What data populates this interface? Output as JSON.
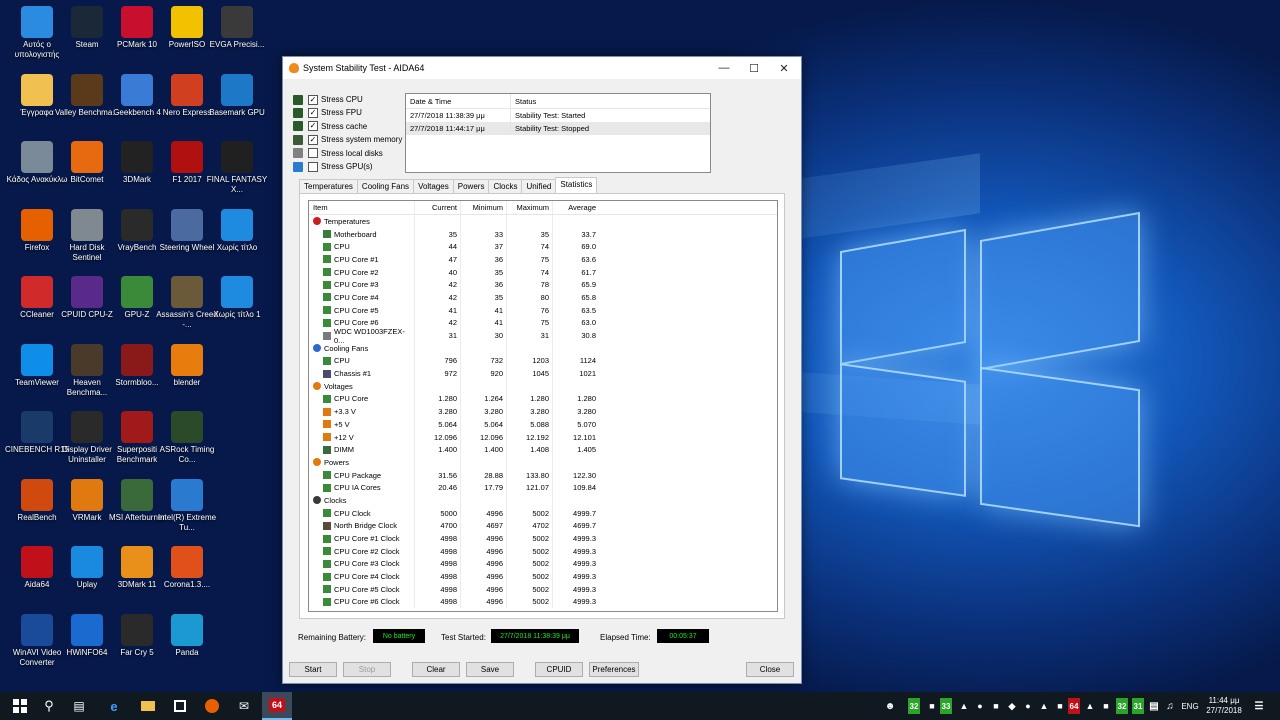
{
  "desktop": {
    "icons": [
      {
        "label": "Αυτός ο υπολογιστής",
        "icon": "computer-icon",
        "color": "#2a8be0"
      },
      {
        "label": "Steam",
        "icon": "steam-icon",
        "color": "#1b2838"
      },
      {
        "label": "PCMark 10",
        "icon": "pcmark-icon",
        "color": "#c8102e"
      },
      {
        "label": "PowerISO",
        "icon": "disc-icon",
        "color": "#f2c200"
      },
      {
        "label": "EVGA Precisi...",
        "icon": "evga-icon",
        "color": "#3a3a3a"
      },
      {
        "label": "Έγγραφα",
        "icon": "documents-icon",
        "color": "#f0c050"
      },
      {
        "label": "Valley Benchma...",
        "icon": "valley-icon",
        "color": "#5a3a1a"
      },
      {
        "label": "Geekbench 4",
        "icon": "geekbench-icon",
        "color": "#3a7bd5"
      },
      {
        "label": "Nero Express",
        "icon": "nero-icon",
        "color": "#d04020"
      },
      {
        "label": "Basemark GPU",
        "icon": "basemark-icon",
        "color": "#1e78c8"
      },
      {
        "label": "Κάδος Ανακύκλω",
        "icon": "recycle-bin-icon",
        "color": "#7a8a99"
      },
      {
        "label": "BitComet",
        "icon": "bitcomet-icon",
        "color": "#e86a10"
      },
      {
        "label": "3DMark",
        "icon": "3dmark-icon",
        "color": "#222222"
      },
      {
        "label": "F1 2017",
        "icon": "f1-icon",
        "color": "#b01010"
      },
      {
        "label": "FINAL FANTASY X...",
        "icon": "final-fantasy-icon",
        "color": "#202020"
      },
      {
        "label": "Firefox",
        "icon": "firefox-icon",
        "color": "#e66000"
      },
      {
        "label": "Hard Disk Sentinel",
        "icon": "hdd-icon",
        "color": "#808890"
      },
      {
        "label": "VrayBench",
        "icon": "vray-icon",
        "color": "#2a2a2a"
      },
      {
        "label": "Steering Wheel",
        "icon": "steering-wheel-icon",
        "color": "#4a6aa0"
      },
      {
        "label": "Χωρίς τίτλο",
        "icon": "window-icon",
        "color": "#1e8ae0"
      },
      {
        "label": "CCleaner",
        "icon": "ccleaner-icon",
        "color": "#d02a2a"
      },
      {
        "label": "CPUID CPU-Z",
        "icon": "cpuz-icon",
        "color": "#5a2a8a"
      },
      {
        "label": "GPU-Z",
        "icon": "gpuz-icon",
        "color": "#3a8a3a"
      },
      {
        "label": "Assassin's Creed -...",
        "icon": "assassins-creed-icon",
        "color": "#6a5a3a"
      },
      {
        "label": "Χωρίς τίτλο 1",
        "icon": "window-icon",
        "color": "#1e8ae0"
      },
      {
        "label": "TeamViewer",
        "icon": "teamviewer-icon",
        "color": "#0e8ee9"
      },
      {
        "label": "Heaven Benchma...",
        "icon": "heaven-icon",
        "color": "#4a3a2a"
      },
      {
        "label": "Stormbloo...",
        "icon": "stormblood-icon",
        "color": "#8a1a1a"
      },
      {
        "label": "blender",
        "icon": "blender-icon",
        "color": "#e87d0d"
      },
      {
        "label": "",
        "icon": "",
        "color": ""
      },
      {
        "label": "CINEBENCH R15",
        "icon": "cinebench-icon",
        "color": "#1a3a6a"
      },
      {
        "label": "Display Driver Uninstaller",
        "icon": "ddu-icon",
        "color": "#2a2a2a"
      },
      {
        "label": "Superpositi Benchmark",
        "icon": "superposition-icon",
        "color": "#a01a1a"
      },
      {
        "label": "ASRock Timing Co...",
        "icon": "asrock-icon",
        "color": "#2a4a2a"
      },
      {
        "label": "",
        "icon": "",
        "color": ""
      },
      {
        "label": "RealBench",
        "icon": "realbench-icon",
        "color": "#d04a10"
      },
      {
        "label": "VRMark",
        "icon": "vrmark-icon",
        "color": "#e07a10"
      },
      {
        "label": "MSI Afterburner",
        "icon": "msi-icon",
        "color": "#3a6a3a"
      },
      {
        "label": "Intel(R) Extreme Tu...",
        "icon": "intel-xtu-icon",
        "color": "#2a7ad0"
      },
      {
        "label": "",
        "icon": "",
        "color": ""
      },
      {
        "label": "Aida64",
        "icon": "aida64-icon",
        "color": "#c0101a"
      },
      {
        "label": "Uplay",
        "icon": "uplay-icon",
        "color": "#1a8ae0"
      },
      {
        "label": "3DMark 11",
        "icon": "3dmark11-icon",
        "color": "#e8901a"
      },
      {
        "label": "Corona1.3....",
        "icon": "corona-icon",
        "color": "#e0501a"
      },
      {
        "label": "",
        "icon": "",
        "color": ""
      },
      {
        "label": "WinAVI Video Converter",
        "icon": "winavi-icon",
        "color": "#1a4a9a"
      },
      {
        "label": "HWiNFO64",
        "icon": "hwinfo-icon",
        "color": "#1a6ad0"
      },
      {
        "label": "Far Cry 5",
        "icon": "farcry-icon",
        "color": "#2a2a2a"
      },
      {
        "label": "Panda",
        "icon": "panda-icon",
        "color": "#1a9ad0"
      }
    ]
  },
  "window": {
    "title": "System Stability Test - AIDA64",
    "stress": [
      {
        "label": "Stress CPU",
        "checked": true,
        "icon": "cpu-icon"
      },
      {
        "label": "Stress FPU",
        "checked": true,
        "icon": "fpu-icon"
      },
      {
        "label": "Stress cache",
        "checked": true,
        "icon": "cache-icon"
      },
      {
        "label": "Stress system memory",
        "checked": true,
        "icon": "memory-icon"
      },
      {
        "label": "Stress local disks",
        "checked": false,
        "icon": "disk-icon"
      },
      {
        "label": "Stress GPU(s)",
        "checked": false,
        "icon": "gpu-icon"
      }
    ],
    "log": {
      "headers": [
        "Date & Time",
        "Status"
      ],
      "rows": [
        {
          "time": "27/7/2018 11:38:39 μμ",
          "status": "Stability Test: Started"
        },
        {
          "time": "27/7/2018 11:44:17 μμ",
          "status": "Stability Test: Stopped"
        }
      ]
    },
    "tabs": [
      "Temperatures",
      "Cooling Fans",
      "Voltages",
      "Powers",
      "Clocks",
      "Unified",
      "Statistics"
    ],
    "active_tab": "Statistics",
    "stats": {
      "headers": [
        "Item",
        "Current",
        "Minimum",
        "Maximum",
        "Average"
      ],
      "rows": [
        {
          "kind": "group",
          "name": "Temperatures",
          "icon": "thermometer-icon"
        },
        {
          "kind": "item",
          "name": "Motherboard",
          "icon": "motherboard-icon",
          "v": [
            "35",
            "33",
            "35",
            "33.7"
          ]
        },
        {
          "kind": "item",
          "name": "CPU",
          "icon": "cpu-icon",
          "v": [
            "44",
            "37",
            "74",
            "69.0"
          ]
        },
        {
          "kind": "item",
          "name": "CPU Core #1",
          "icon": "cpu-icon",
          "v": [
            "47",
            "36",
            "75",
            "63.6"
          ]
        },
        {
          "kind": "item",
          "name": "CPU Core #2",
          "icon": "cpu-icon",
          "v": [
            "40",
            "35",
            "74",
            "61.7"
          ]
        },
        {
          "kind": "item",
          "name": "CPU Core #3",
          "icon": "cpu-icon",
          "v": [
            "42",
            "36",
            "78",
            "65.9"
          ]
        },
        {
          "kind": "item",
          "name": "CPU Core #4",
          "icon": "cpu-icon",
          "v": [
            "42",
            "35",
            "80",
            "65.8"
          ]
        },
        {
          "kind": "item",
          "name": "CPU Core #5",
          "icon": "cpu-icon",
          "v": [
            "41",
            "41",
            "76",
            "63.5"
          ]
        },
        {
          "kind": "item",
          "name": "CPU Core #6",
          "icon": "cpu-icon",
          "v": [
            "42",
            "41",
            "75",
            "63.0"
          ]
        },
        {
          "kind": "item",
          "name": "WDC WD1003FZEX-0...",
          "icon": "disk-icon",
          "v": [
            "31",
            "30",
            "31",
            "30.8"
          ]
        },
        {
          "kind": "group",
          "name": "Cooling Fans",
          "icon": "fan-icon"
        },
        {
          "kind": "item",
          "name": "CPU",
          "icon": "cpu-icon",
          "v": [
            "796",
            "732",
            "1203",
            "1124"
          ]
        },
        {
          "kind": "item",
          "name": "Chassis #1",
          "icon": "chassis-icon",
          "v": [
            "972",
            "920",
            "1045",
            "1021"
          ]
        },
        {
          "kind": "group",
          "name": "Voltages",
          "icon": "voltage-icon"
        },
        {
          "kind": "item",
          "name": "CPU Core",
          "icon": "cpu-icon",
          "v": [
            "1.280",
            "1.264",
            "1.280",
            "1.280"
          ]
        },
        {
          "kind": "item",
          "name": "+3.3 V",
          "icon": "voltage-icon",
          "v": [
            "3.280",
            "3.280",
            "3.280",
            "3.280"
          ]
        },
        {
          "kind": "item",
          "name": "+5 V",
          "icon": "voltage-icon",
          "v": [
            "5.064",
            "5.064",
            "5.088",
            "5.070"
          ]
        },
        {
          "kind": "item",
          "name": "+12 V",
          "icon": "voltage-icon",
          "v": [
            "12.096",
            "12.096",
            "12.192",
            "12.101"
          ]
        },
        {
          "kind": "item",
          "name": "DIMM",
          "icon": "memory-icon",
          "v": [
            "1.400",
            "1.400",
            "1.408",
            "1.405"
          ]
        },
        {
          "kind": "group",
          "name": "Powers",
          "icon": "power-icon"
        },
        {
          "kind": "item",
          "name": "CPU Package",
          "icon": "cpu-icon",
          "v": [
            "31.56",
            "28.88",
            "133.80",
            "122.30"
          ]
        },
        {
          "kind": "item",
          "name": "CPU IA Cores",
          "icon": "cpu-icon",
          "v": [
            "20.46",
            "17.79",
            "121.07",
            "109.84"
          ]
        },
        {
          "kind": "group",
          "name": "Clocks",
          "icon": "clock-icon"
        },
        {
          "kind": "item",
          "name": "CPU Clock",
          "icon": "cpu-icon",
          "v": [
            "5000",
            "4996",
            "5002",
            "4999.7"
          ]
        },
        {
          "kind": "item",
          "name": "North Bridge Clock",
          "icon": "northbridge-icon",
          "v": [
            "4700",
            "4697",
            "4702",
            "4699.7"
          ]
        },
        {
          "kind": "item",
          "name": "CPU Core #1 Clock",
          "icon": "cpu-icon",
          "v": [
            "4998",
            "4996",
            "5002",
            "4999.3"
          ]
        },
        {
          "kind": "item",
          "name": "CPU Core #2 Clock",
          "icon": "cpu-icon",
          "v": [
            "4998",
            "4996",
            "5002",
            "4999.3"
          ]
        },
        {
          "kind": "item",
          "name": "CPU Core #3 Clock",
          "icon": "cpu-icon",
          "v": [
            "4998",
            "4996",
            "5002",
            "4999.3"
          ]
        },
        {
          "kind": "item",
          "name": "CPU Core #4 Clock",
          "icon": "cpu-icon",
          "v": [
            "4998",
            "4996",
            "5002",
            "4999.3"
          ]
        },
        {
          "kind": "item",
          "name": "CPU Core #5 Clock",
          "icon": "cpu-icon",
          "v": [
            "4998",
            "4996",
            "5002",
            "4999.3"
          ]
        },
        {
          "kind": "item",
          "name": "CPU Core #6 Clock",
          "icon": "cpu-icon",
          "v": [
            "4998",
            "4996",
            "5002",
            "4999.3"
          ]
        }
      ]
    },
    "status": {
      "battery_label": "Remaining Battery:",
      "battery_value": "No battery",
      "started_label": "Test Started:",
      "started_value": "27/7/2018 11:38:39 μμ",
      "elapsed_label": "Elapsed Time:",
      "elapsed_value": "00:05:37"
    },
    "buttons": {
      "start": "Start",
      "stop": "Stop",
      "clear": "Clear",
      "save": "Save",
      "cpuid": "CPUID",
      "preferences": "Preferences",
      "close": "Close"
    }
  },
  "taskbar": {
    "tray_numbers": [
      "32",
      "33",
      "32",
      "31"
    ],
    "language": "ENG",
    "time": "11:44 μμ",
    "date": "27/7/2018",
    "aida_label": "64"
  },
  "colors": {
    "accent": "#0078d7",
    "tray_green": "#2aa52a",
    "status_text": "#1ee81e"
  }
}
